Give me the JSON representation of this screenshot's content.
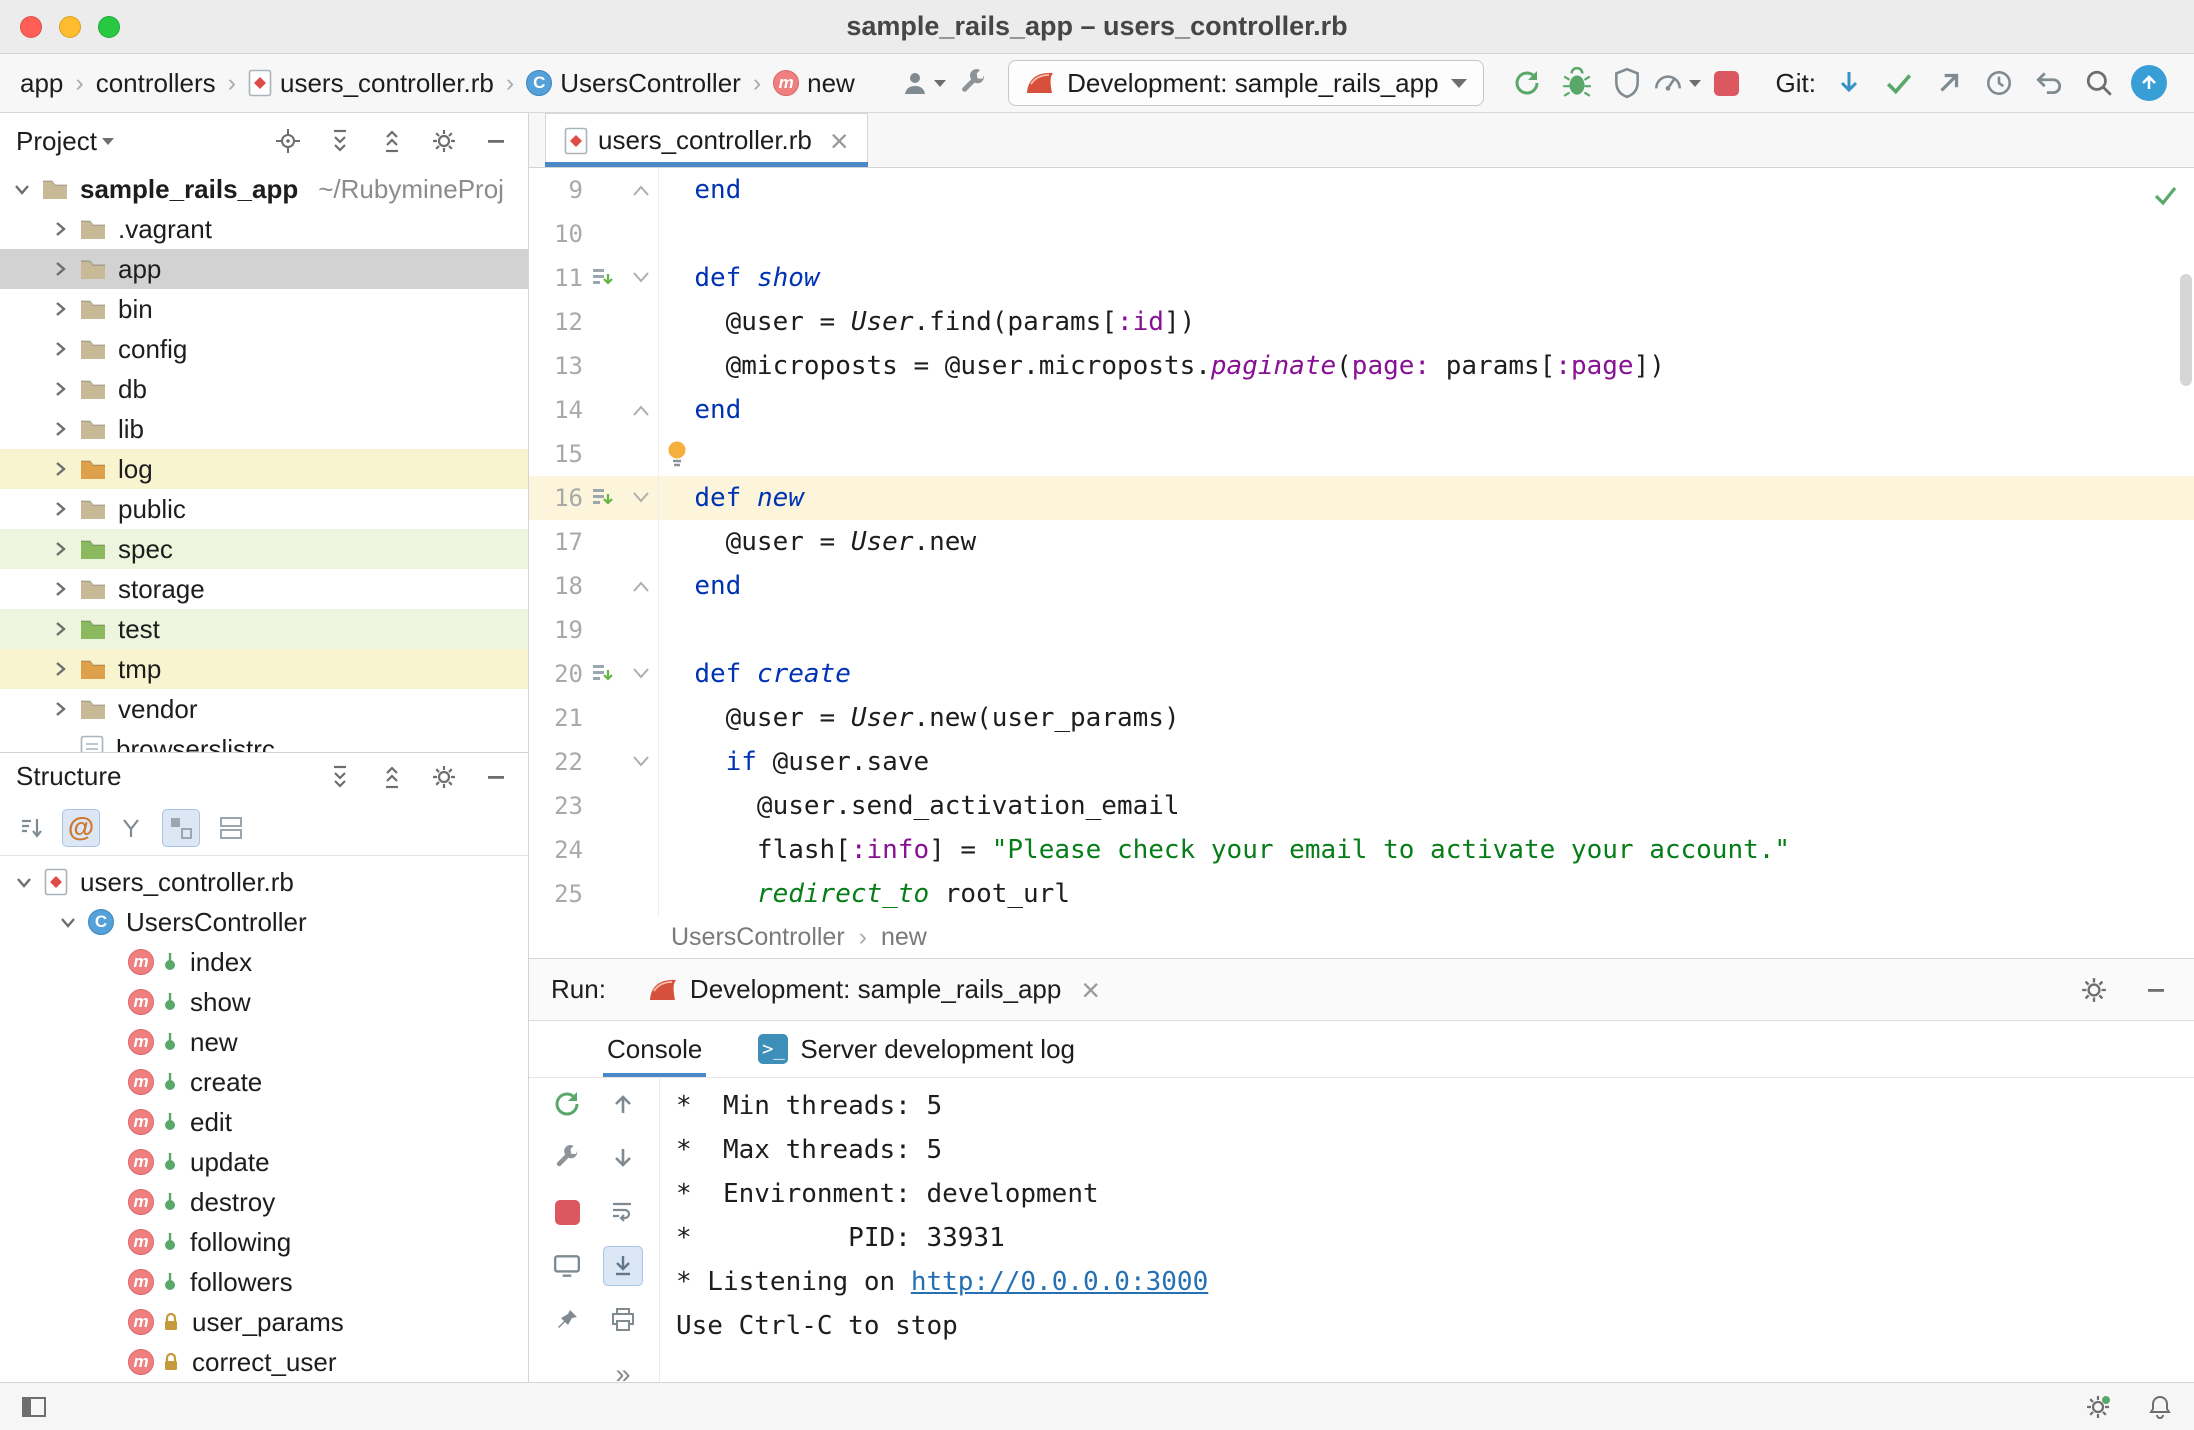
{
  "window": {
    "title": "sample_rails_app – users_controller.rb"
  },
  "toolbar": {
    "breadcrumbs": [
      {
        "label": "app",
        "icon": null
      },
      {
        "label": "controllers",
        "icon": null
      },
      {
        "label": "users_controller.rb",
        "icon": "ruby-file"
      },
      {
        "label": "UsersController",
        "icon": "class"
      },
      {
        "label": "new",
        "icon": "method"
      }
    ],
    "run_config_label": "Development: sample_rails_app",
    "git_label": "Git:"
  },
  "project_panel": {
    "title": "Project",
    "items": [
      {
        "name": "sample_rails_app",
        "suffix": "~/RubymineProj",
        "type": "folder",
        "color": "default",
        "level": 0,
        "expanded": true,
        "bold": true
      },
      {
        "name": ".vagrant",
        "type": "folder",
        "color": "default",
        "level": 1
      },
      {
        "name": "app",
        "type": "folder",
        "color": "default",
        "level": 1,
        "selected": true
      },
      {
        "name": "bin",
        "type": "folder",
        "color": "default",
        "level": 1
      },
      {
        "name": "config",
        "type": "folder",
        "color": "default",
        "level": 1
      },
      {
        "name": "db",
        "type": "folder",
        "color": "default",
        "level": 1
      },
      {
        "name": "lib",
        "type": "folder",
        "color": "default",
        "level": 1
      },
      {
        "name": "log",
        "type": "folder",
        "color": "excluded",
        "level": 1,
        "row": "yellow"
      },
      {
        "name": "public",
        "type": "folder",
        "color": "default",
        "level": 1
      },
      {
        "name": "spec",
        "type": "folder",
        "color": "test",
        "level": 1,
        "row": "green"
      },
      {
        "name": "storage",
        "type": "folder",
        "color": "default",
        "level": 1
      },
      {
        "name": "test",
        "type": "folder",
        "color": "test",
        "level": 1,
        "row": "green"
      },
      {
        "name": "tmp",
        "type": "folder",
        "color": "excluded",
        "level": 1,
        "row": "yellow"
      },
      {
        "name": "vendor",
        "type": "folder",
        "color": "default",
        "level": 1
      },
      {
        "name": "browserslistrc",
        "type": "file",
        "level": 1
      }
    ]
  },
  "structure_panel": {
    "title": "Structure",
    "file": "users_controller.rb",
    "class_name": "UsersController",
    "methods": [
      {
        "name": "index"
      },
      {
        "name": "show"
      },
      {
        "name": "new"
      },
      {
        "name": "create"
      },
      {
        "name": "edit"
      },
      {
        "name": "update"
      },
      {
        "name": "destroy"
      },
      {
        "name": "following"
      },
      {
        "name": "followers"
      },
      {
        "name": "user_params",
        "private": true
      },
      {
        "name": "correct_user",
        "private": true
      }
    ]
  },
  "editor": {
    "tab_title": "users_controller.rb",
    "breadcrumb": [
      "UsersController",
      "new"
    ],
    "code_lines": [
      {
        "num": 9,
        "fold": "up",
        "tokens": [
          [
            "  ",
            ""
          ],
          [
            "end",
            "kw"
          ]
        ]
      },
      {
        "num": 10,
        "tokens": []
      },
      {
        "num": 11,
        "run": true,
        "fold": "down",
        "tokens": [
          [
            "  ",
            ""
          ],
          [
            "def",
            "kw"
          ],
          [
            " ",
            ""
          ],
          [
            "show",
            "mname"
          ]
        ]
      },
      {
        "num": 12,
        "tokens": [
          [
            "    ",
            ""
          ],
          [
            "@user",
            "iv"
          ],
          [
            " = ",
            ""
          ],
          [
            "User",
            "const"
          ],
          [
            ".find(params[",
            ""
          ],
          [
            ":id",
            "sym"
          ],
          [
            "])",
            ""
          ]
        ]
      },
      {
        "num": 13,
        "tokens": [
          [
            "    ",
            ""
          ],
          [
            "@microposts",
            "iv"
          ],
          [
            " = ",
            ""
          ],
          [
            "@user",
            "iv"
          ],
          [
            ".microposts.",
            ""
          ],
          [
            "paginate",
            "mcall"
          ],
          [
            "(",
            ""
          ],
          [
            "page:",
            "sym"
          ],
          [
            " params[",
            ""
          ],
          [
            ":page",
            "sym"
          ],
          [
            "])",
            ""
          ]
        ]
      },
      {
        "num": 14,
        "fold": "up",
        "tokens": [
          [
            "  ",
            ""
          ],
          [
            "end",
            "kw"
          ]
        ]
      },
      {
        "num": 15,
        "bulb": true,
        "tokens": []
      },
      {
        "num": 16,
        "run": true,
        "fold": "down",
        "current": true,
        "tokens": [
          [
            "  ",
            ""
          ],
          [
            "def",
            "kw"
          ],
          [
            " ",
            ""
          ],
          [
            "new",
            "mname"
          ]
        ]
      },
      {
        "num": 17,
        "tokens": [
          [
            "    ",
            ""
          ],
          [
            "@user",
            "iv"
          ],
          [
            " = ",
            ""
          ],
          [
            "User",
            "const"
          ],
          [
            ".new",
            ""
          ]
        ]
      },
      {
        "num": 18,
        "fold": "up",
        "tokens": [
          [
            "  ",
            ""
          ],
          [
            "end",
            "kw"
          ]
        ]
      },
      {
        "num": 19,
        "tokens": []
      },
      {
        "num": 20,
        "run": true,
        "fold": "down",
        "tokens": [
          [
            "  ",
            ""
          ],
          [
            "def",
            "kw"
          ],
          [
            " ",
            ""
          ],
          [
            "create",
            "mname"
          ]
        ]
      },
      {
        "num": 21,
        "tokens": [
          [
            "    ",
            ""
          ],
          [
            "@user",
            "iv"
          ],
          [
            " = ",
            ""
          ],
          [
            "User",
            "const"
          ],
          [
            ".new(user_params)",
            ""
          ]
        ]
      },
      {
        "num": 22,
        "fold": "down",
        "tokens": [
          [
            "    ",
            ""
          ],
          [
            "if",
            "kw"
          ],
          [
            " ",
            ""
          ],
          [
            "@user",
            "iv"
          ],
          [
            ".save",
            ""
          ]
        ]
      },
      {
        "num": 23,
        "tokens": [
          [
            "      ",
            ""
          ],
          [
            "@user",
            "iv"
          ],
          [
            ".send_activation_email",
            ""
          ]
        ]
      },
      {
        "num": 24,
        "tokens": [
          [
            "      flash[",
            ""
          ],
          [
            ":info",
            "sym"
          ],
          [
            "] = ",
            ""
          ],
          [
            "\"Please check your email to activate your account.\"",
            "str"
          ]
        ]
      },
      {
        "num": 25,
        "tokens": [
          [
            "      ",
            ""
          ],
          [
            "redirect_to",
            "rails"
          ],
          [
            " root_url",
            ""
          ]
        ]
      }
    ]
  },
  "run_panel": {
    "label": "Run:",
    "tab_title": "Development: sample_rails_app",
    "tabs": [
      {
        "label": "Console",
        "selected": true
      },
      {
        "label": "Server development log",
        "icon": "console"
      }
    ],
    "console_lines": [
      {
        "tokens": [
          [
            "*  Min threads: 5",
            ""
          ]
        ]
      },
      {
        "tokens": [
          [
            "*  Max threads: 5",
            ""
          ]
        ]
      },
      {
        "tokens": [
          [
            "*  Environment: development",
            ""
          ]
        ]
      },
      {
        "tokens": [
          [
            "*          PID: 33931",
            ""
          ]
        ]
      },
      {
        "tokens": [
          [
            "* Listening on ",
            ""
          ],
          [
            "http://0.0.0.0:3000",
            "link"
          ]
        ]
      },
      {
        "tokens": [
          [
            "Use Ctrl-C to stop",
            ""
          ]
        ]
      }
    ]
  },
  "colors": {
    "keyword": "#0033B3",
    "string": "#067D17",
    "symbol": "#871094",
    "selection_bg": "#D2D2D2",
    "excluded_row_bg": "#F9F4D0",
    "test_row_bg": "#EDF5DE",
    "current_line_bg": "#FCF5DB",
    "tab_accent": "#4A88C7",
    "run_green": "#59A869",
    "stop_red": "#DB5860"
  }
}
